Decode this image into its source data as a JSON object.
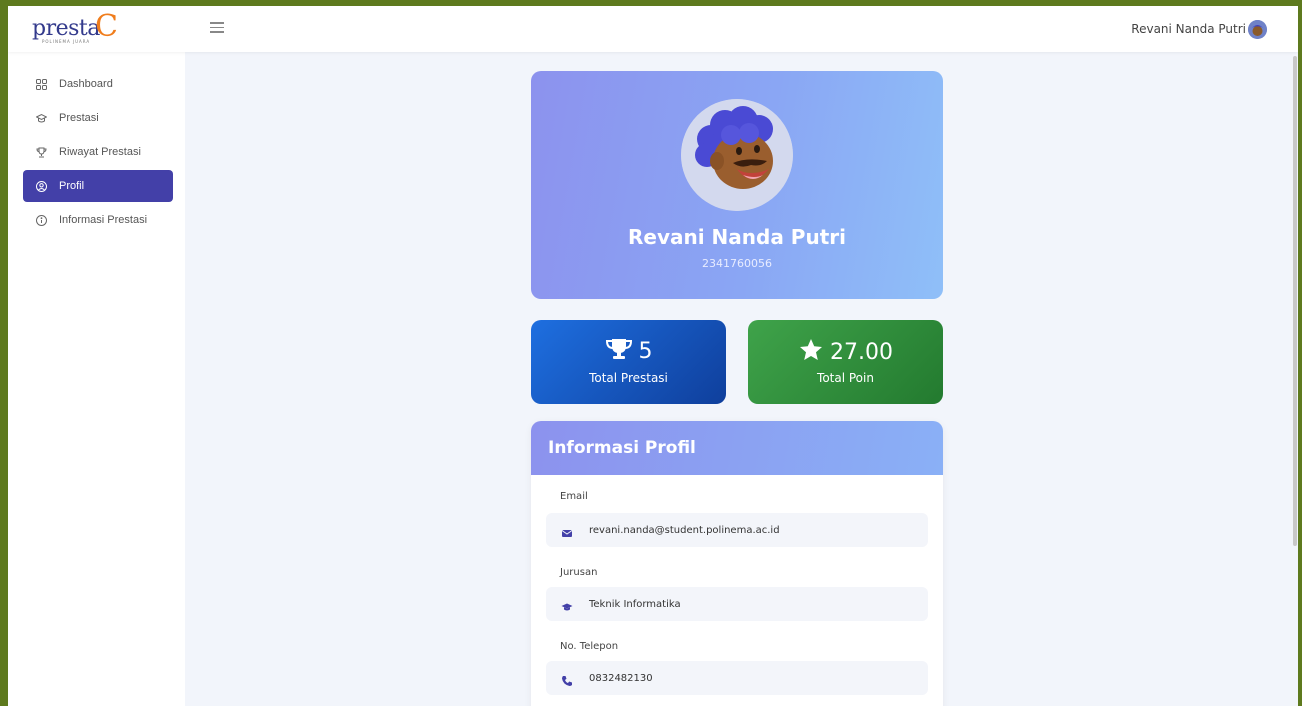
{
  "header": {
    "logo_text": "presta",
    "logo_c": "C",
    "logo_sub": "POLINEMA JUARA",
    "user_name": "Revani Nanda Putri"
  },
  "sidebar": {
    "items": [
      {
        "label": "Dashboard",
        "icon": "grid-icon"
      },
      {
        "label": "Prestasi",
        "icon": "graduation-cap-icon"
      },
      {
        "label": "Riwayat Prestasi",
        "icon": "trophy-outline-icon"
      },
      {
        "label": "Profil",
        "icon": "user-circle-icon",
        "active": true
      },
      {
        "label": "Informasi Prestasi",
        "icon": "info-icon"
      }
    ]
  },
  "profile": {
    "name": "Revani Nanda Putri",
    "nim": "2341760056"
  },
  "stats": {
    "prestasi": {
      "value": "5",
      "label": "Total Prestasi",
      "icon": "trophy-icon"
    },
    "poin": {
      "value": "27.00",
      "label": "Total Poin",
      "icon": "star-icon"
    }
  },
  "info": {
    "title": "Informasi Profil",
    "email_label": "Email",
    "email_value": "revani.nanda@student.polinema.ac.id",
    "jurusan_label": "Jurusan",
    "jurusan_value": "Teknik Informatika",
    "telepon_label": "No. Telepon",
    "telepon_value": "0832482130"
  },
  "colors": {
    "accent": "#4340a8",
    "stat_blue": "#1e6fe0",
    "stat_green": "#3fa34a",
    "frame": "#5e7a1e"
  }
}
